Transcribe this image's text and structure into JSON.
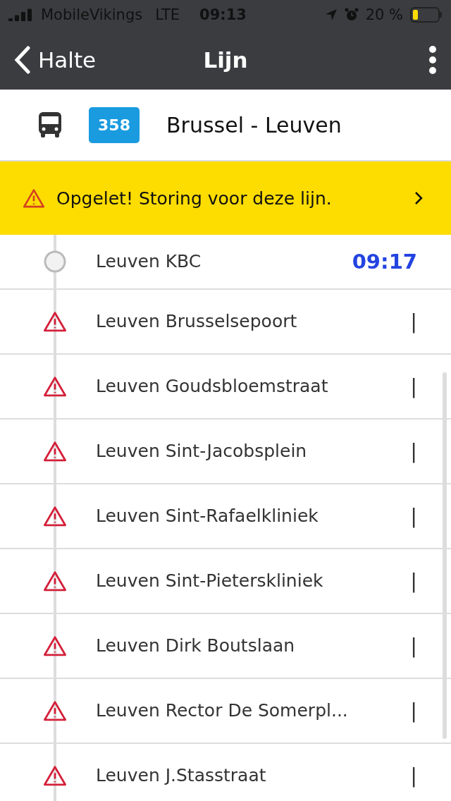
{
  "status_bar": {
    "carrier": "MobileVikings",
    "network": "LTE",
    "time": "09:13",
    "battery": "20 %"
  },
  "nav": {
    "back_label": "Halte",
    "title": "Lijn"
  },
  "line": {
    "number": "358",
    "name": "Brussel - Leuven"
  },
  "alert": {
    "text": "Opgelet! Storing voor deze lijn."
  },
  "stops": [
    {
      "kind": "current",
      "name": "Leuven KBC",
      "time": "09:17"
    },
    {
      "kind": "disrupted",
      "name": "Leuven Brusselsepoort",
      "time": "|"
    },
    {
      "kind": "disrupted",
      "name": "Leuven Goudsbloemstraat",
      "time": "|"
    },
    {
      "kind": "disrupted",
      "name": "Leuven Sint-Jacobsplein",
      "time": "|"
    },
    {
      "kind": "disrupted",
      "name": "Leuven Sint-Rafaelkliniek",
      "time": "|"
    },
    {
      "kind": "disrupted",
      "name": "Leuven Sint-Pieterskliniek",
      "time": "|"
    },
    {
      "kind": "disrupted",
      "name": "Leuven Dirk Boutslaan",
      "time": "|"
    },
    {
      "kind": "disrupted",
      "name": "Leuven Rector De Somerpl...",
      "time": "|"
    },
    {
      "kind": "disrupted",
      "name": "Leuven J.Stasstraat",
      "time": "|"
    }
  ]
}
